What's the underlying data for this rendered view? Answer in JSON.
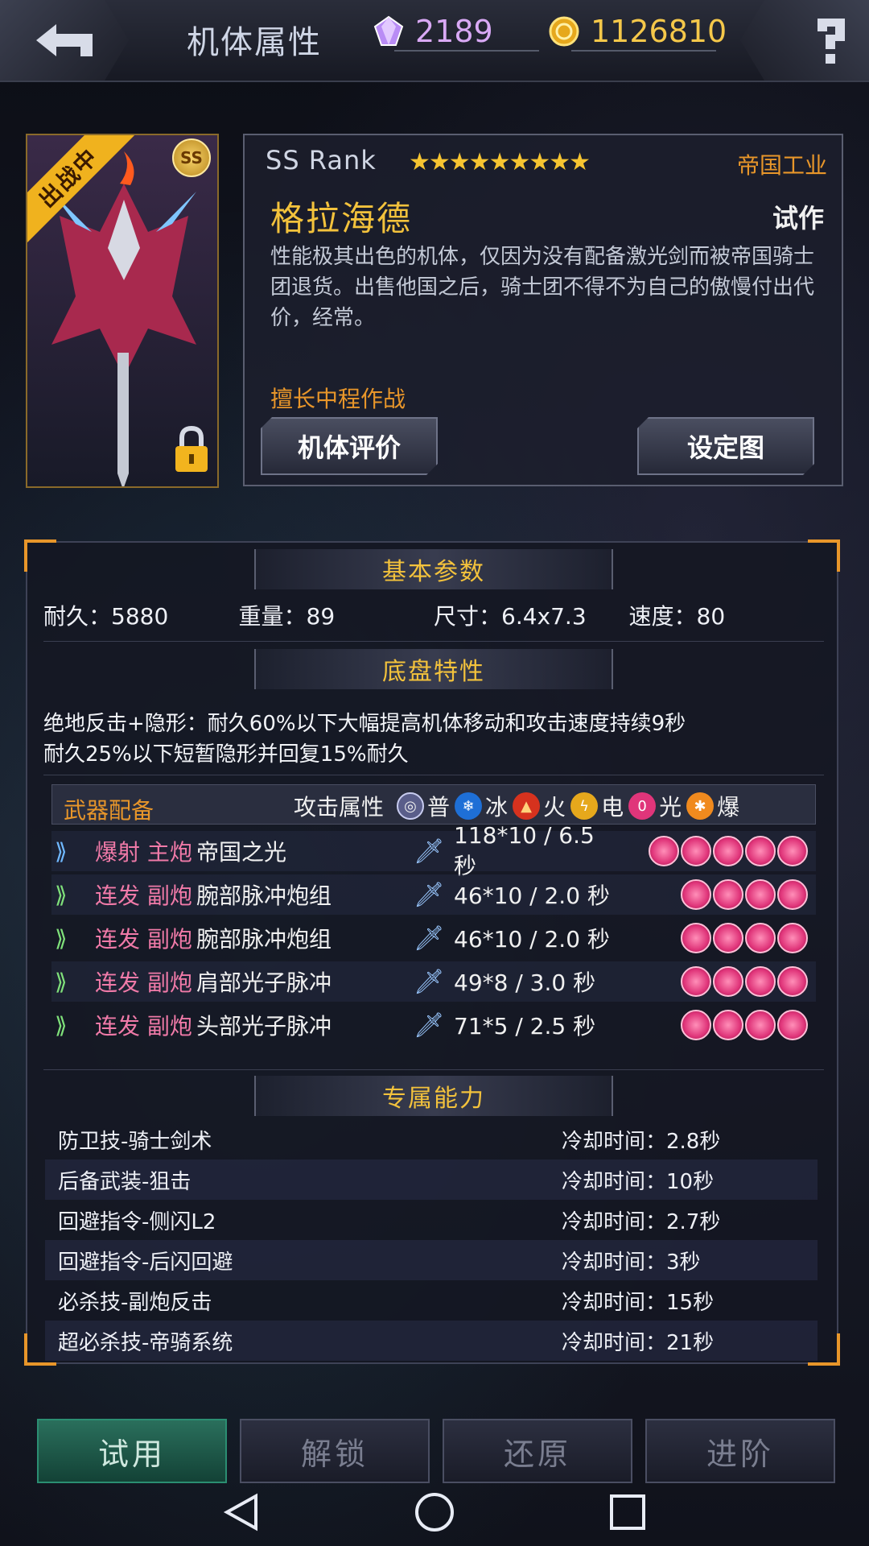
{
  "header": {
    "title": "机体属性",
    "gems": "2189",
    "coins": "1126810"
  },
  "portrait": {
    "badge": "出战中",
    "rank_badge": "SS"
  },
  "info": {
    "rank": "SS  Rank",
    "stars": "★★★★★★★★★",
    "star_count": 9,
    "maker": "帝国工业",
    "name": "格拉海德",
    "tag": "试作",
    "description": "性能极其出色的机体，仅因为没有配备激光剑而被帝国骑士团退货。出售他国之后，骑士团不得不为自己的傲慢付出代价，经常。",
    "specialty": "擅长中程作战",
    "eval_button": "机体评价",
    "art_button": "设定图"
  },
  "basic": {
    "header": "基本参数",
    "durability": "耐久：5880",
    "weight": "重量：89",
    "size": "尺寸：6.4x7.3",
    "speed": "速度：80"
  },
  "chassis": {
    "header": "底盘特性",
    "line1": "绝地反击+隐形：耐久60%以下大幅提高机体移动和攻击速度持续9秒",
    "line2": "耐久25%以下短暂隐形并回复15%耐久"
  },
  "weapons": {
    "title": "武器配备",
    "attr_label": "攻击属性",
    "elements": [
      "普",
      "冰",
      "火",
      "电",
      "光",
      "爆"
    ],
    "rows": [
      {
        "type": "爆射 主炮",
        "name": "帝国之光",
        "damage": "118*10 / 6.5 秒",
        "slots": 5
      },
      {
        "type": "连发 副炮",
        "name": "腕部脉冲炮组",
        "damage": "46*10 / 2.0 秒",
        "slots": 4
      },
      {
        "type": "连发 副炮",
        "name": "腕部脉冲炮组",
        "damage": "46*10 / 2.0 秒",
        "slots": 4
      },
      {
        "type": "连发 副炮",
        "name": "肩部光子脉冲",
        "damage": "49*8 / 3.0 秒",
        "slots": 4
      },
      {
        "type": "连发 副炮",
        "name": "头部光子脉冲",
        "damage": "71*5 / 2.5 秒",
        "slots": 4
      }
    ]
  },
  "abilities": {
    "header": "专属能力",
    "rows": [
      {
        "name": "防卫技-骑士剑术",
        "cooldown": "冷却时间：2.8秒"
      },
      {
        "name": "后备武装-狙击",
        "cooldown": "冷却时间：10秒"
      },
      {
        "name": "回避指令-侧闪L2",
        "cooldown": "冷却时间：2.7秒"
      },
      {
        "name": "回避指令-后闪回避",
        "cooldown": "冷却时间：3秒"
      },
      {
        "name": "必杀技-副炮反击",
        "cooldown": "冷却时间：15秒"
      },
      {
        "name": "超必杀技-帝骑系统",
        "cooldown": "冷却时间：21秒"
      }
    ]
  },
  "footer": {
    "try": "试用",
    "unlock": "解锁",
    "reset": "还原",
    "advance": "进阶"
  },
  "colors": {
    "accent_orange": "#e8962a",
    "gold": "#f3c23c",
    "pink": "#f07aa8",
    "green_button": "#2a6f5c"
  }
}
